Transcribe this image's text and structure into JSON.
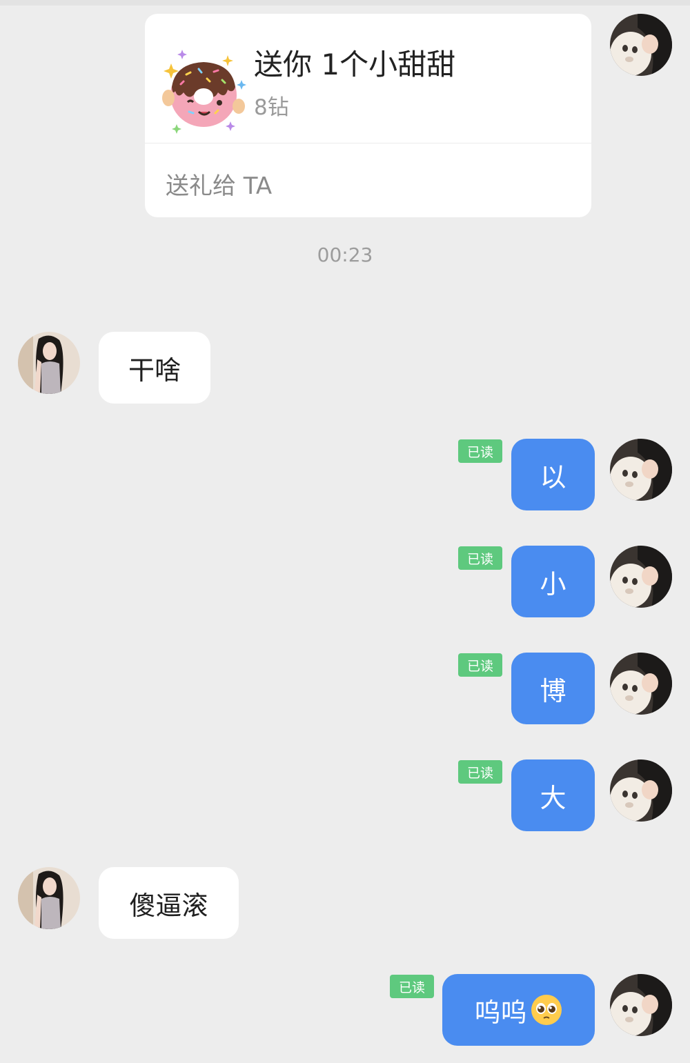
{
  "gift": {
    "title": "送你 1个小甜甜",
    "price": "8钻",
    "action": "送礼给 TA",
    "image_icon": "donut-sticker"
  },
  "timestamp": "00:23",
  "read_label": "已读",
  "messages": [
    {
      "side": "in",
      "text": "干啥"
    },
    {
      "side": "out",
      "text": "以",
      "read": "已读"
    },
    {
      "side": "out",
      "text": "小",
      "read": "已读"
    },
    {
      "side": "out",
      "text": "博",
      "read": "已读"
    },
    {
      "side": "out",
      "text": "大",
      "read": "已读"
    },
    {
      "side": "in",
      "text": "傻逼滚"
    },
    {
      "side": "out",
      "text": "呜呜",
      "emoji": "pleading-face-emoji",
      "read": "已读"
    }
  ],
  "colors": {
    "background": "#ededed",
    "incoming_bubble": "#ffffff",
    "outgoing_bubble": "#4a8cf0",
    "read_badge": "#5ec97e"
  }
}
